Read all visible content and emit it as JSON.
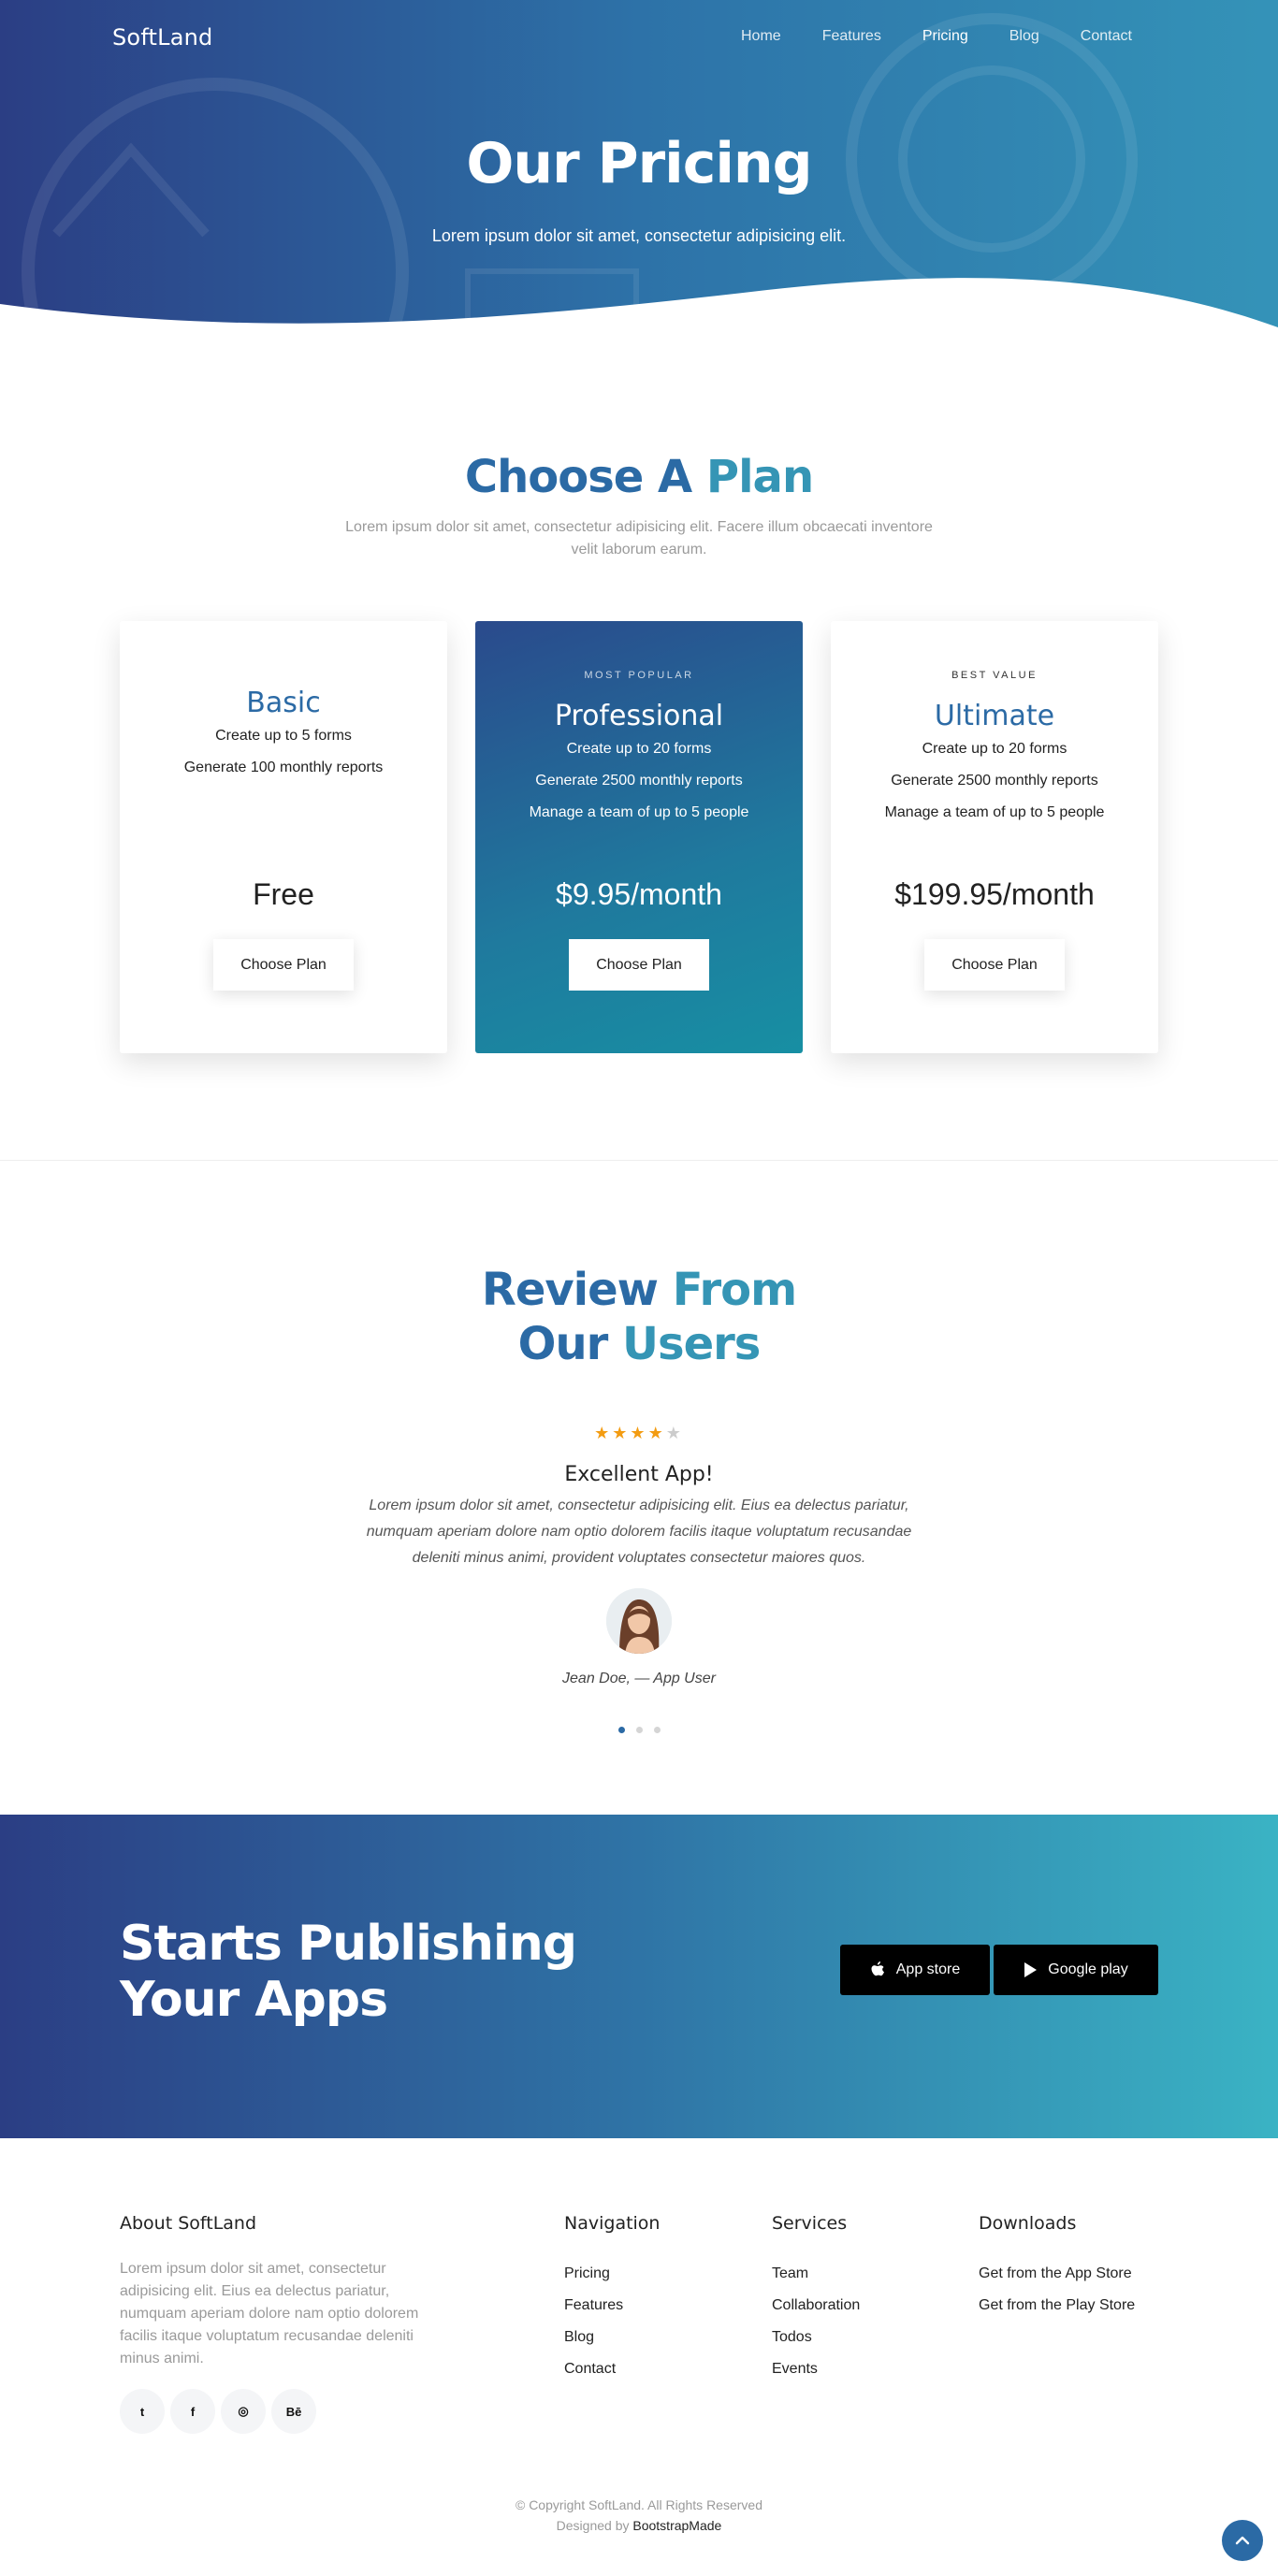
{
  "header": {
    "brand": "SoftLand",
    "nav": [
      "Home",
      "Features",
      "Pricing",
      "Blog",
      "Contact"
    ],
    "active_nav": "Pricing"
  },
  "hero": {
    "title": "Our Pricing",
    "subtitle": "Lorem ipsum dolor sit amet, consectetur adipisicing elit."
  },
  "pricing": {
    "title_part1": "Choose A",
    "title_part2": "Plan",
    "subtitle": "Lorem ipsum dolor sit amet, consectetur adipisicing elit. Facere illum obcaecati inventore velit laborum earum.",
    "plans": [
      {
        "eyebrow": "",
        "name": "Basic",
        "features": [
          "Create up to 5 forms",
          "Generate 100 monthly reports"
        ],
        "price": "Free",
        "button": "Choose Plan"
      },
      {
        "eyebrow": "MOST POPULAR",
        "name": "Professional",
        "features": [
          "Create up to 20 forms",
          "Generate 2500 monthly reports",
          "Manage a team of up to 5 people"
        ],
        "price": "$9.95/month",
        "button": "Choose Plan"
      },
      {
        "eyebrow": "BEST VALUE",
        "name": "Ultimate",
        "features": [
          "Create up to 20 forms",
          "Generate 2500 monthly reports",
          "Manage a team of up to 5 people"
        ],
        "price": "$199.95/month",
        "button": "Choose Plan"
      }
    ]
  },
  "reviews": {
    "title_line1_part1": "Review",
    "title_line1_part2": "From",
    "title_line2_part1": "Our",
    "title_line2_part2": "Users",
    "rating": 4,
    "rating_max": 5,
    "headline": "Excellent App!",
    "body": "Lorem ipsum dolor sit amet, consectetur adipisicing elit. Eius ea delectus pariatur, numquam aperiam dolore nam optio dolorem facilis itaque voluptatum recusandae deleniti minus animi, provident voluptates consectetur maiores quos.",
    "author": "Jean Doe, — App User",
    "slides": 3,
    "active_slide": 1
  },
  "cta": {
    "title_line1": "Starts Publishing",
    "title_line2": "Your Apps",
    "app_store_label": "App store",
    "google_play_label": "Google play"
  },
  "footer": {
    "about_heading": "About SoftLand",
    "about_text": "Lorem ipsum dolor sit amet, consectetur adipisicing elit. Eius ea delectus pariatur, numquam aperiam dolore nam optio dolorem facilis itaque voluptatum recusandae deleniti minus animi.",
    "socials": [
      {
        "icon": "twitter-icon",
        "glyph": "t"
      },
      {
        "icon": "facebook-icon",
        "glyph": "f"
      },
      {
        "icon": "dribbble-icon",
        "glyph": "◎"
      },
      {
        "icon": "behance-icon",
        "glyph": "Bē"
      }
    ],
    "navigation_heading": "Navigation",
    "navigation": [
      "Pricing",
      "Features",
      "Blog",
      "Contact"
    ],
    "services_heading": "Services",
    "services": [
      "Team",
      "Collaboration",
      "Todos",
      "Events"
    ],
    "downloads_heading": "Downloads",
    "downloads": [
      "Get from the App Store",
      "Get from the Play Store"
    ],
    "copyright": "© Copyright SoftLand. All Rights Reserved",
    "designed_by_prefix": "Designed by",
    "designed_by_link": "BootstrapMade"
  },
  "colors": {
    "brand_blue": "#2b6aa5",
    "brand_teal": "#3595b5",
    "star": "#f39c12"
  }
}
